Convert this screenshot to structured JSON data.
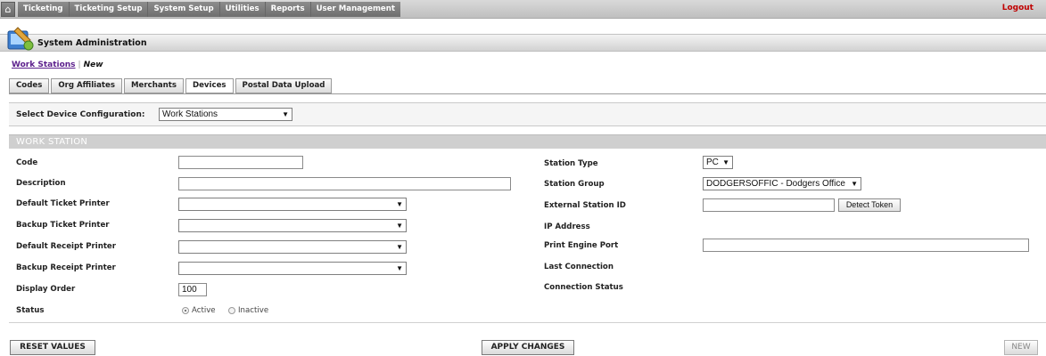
{
  "nav": {
    "home_icon": "house-icon",
    "tabs": [
      "Ticketing",
      "Ticketing Setup",
      "System Setup",
      "Utilities",
      "Reports",
      "User Management"
    ],
    "logout": "Logout"
  },
  "header": {
    "title": "System Administration",
    "logo_icon": "system-admin-icon"
  },
  "breadcrumb": {
    "link": "Work Stations",
    "current": "New"
  },
  "subtabs": [
    "Codes",
    "Org Affiliates",
    "Merchants",
    "Devices",
    "Postal Data Upload"
  ],
  "config": {
    "label": "Select Device Configuration:",
    "value": "Work Stations"
  },
  "section": {
    "title": "WORK STATION"
  },
  "left_fields": {
    "code": {
      "label": "Code",
      "value": ""
    },
    "description": {
      "label": "Description",
      "value": ""
    },
    "default_ticket_printer": {
      "label": "Default Ticket Printer",
      "value": ""
    },
    "backup_ticket_printer": {
      "label": "Backup Ticket Printer",
      "value": ""
    },
    "default_receipt_printer": {
      "label": "Default Receipt Printer",
      "value": ""
    },
    "backup_receipt_printer": {
      "label": "Backup Receipt Printer",
      "value": ""
    },
    "display_order": {
      "label": "Display Order",
      "value": "100"
    },
    "status": {
      "label": "Status",
      "active": "Active",
      "inactive": "Inactive",
      "selected": "Active"
    }
  },
  "right_fields": {
    "station_type": {
      "label": "Station Type",
      "value": "PC"
    },
    "station_group": {
      "label": "Station Group",
      "value": "DODGERSOFFIC - Dodgers Office"
    },
    "external_station_id": {
      "label": "External Station ID",
      "value": "",
      "button": "Detect Token"
    },
    "ip_address": {
      "label": "IP Address",
      "value": ""
    },
    "print_engine_port": {
      "label": "Print Engine Port",
      "value": ""
    },
    "last_connection": {
      "label": "Last Connection",
      "value": ""
    },
    "connection_status": {
      "label": "Connection Status",
      "value": ""
    }
  },
  "footer": {
    "reset": "RESET VALUES",
    "apply": "APPLY CHANGES",
    "new": "NEW"
  },
  "colors": {
    "logout": "#c00000",
    "link": "#5b1e8c",
    "section_header": "#cfcfcf"
  }
}
